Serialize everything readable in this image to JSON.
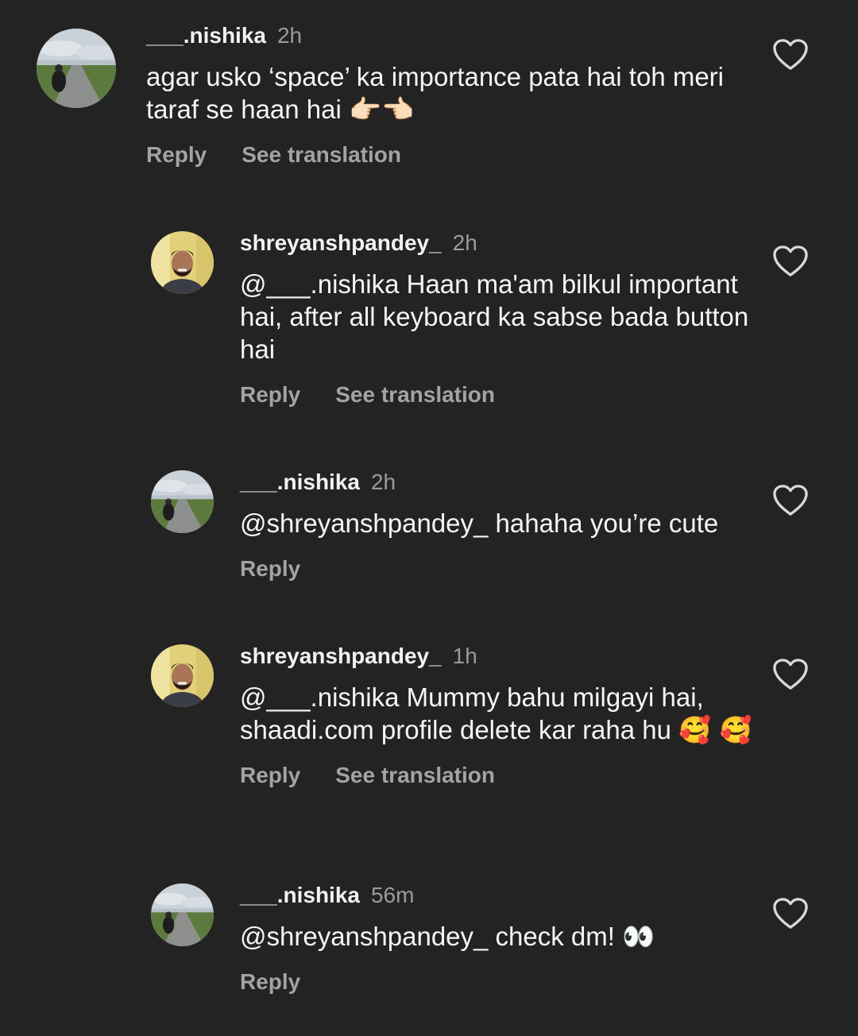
{
  "comments": [
    {
      "username": "___.nishika",
      "time": "2h",
      "text": "agar usko ‘space’ ka importance pata hai toh meri taraf se haan hai",
      "emoji": "👉🏻👈🏻",
      "reply_label": "Reply",
      "translate_label": "See translation"
    },
    {
      "username": "shreyanshpandey_",
      "time": "2h",
      "text": "@___.nishika Haan ma'am bilkul important hai, after all keyboard ka sabse bada button hai",
      "emoji": "",
      "reply_label": "Reply",
      "translate_label": "See translation"
    },
    {
      "username": "___.nishika",
      "time": "2h",
      "text": "@shreyanshpandey_ hahaha you’re cute",
      "emoji": "",
      "reply_label": "Reply",
      "translate_label": ""
    },
    {
      "username": "shreyanshpandey_",
      "time": "1h",
      "text": "@___.nishika Mummy bahu milgayi hai, shaadi.com profile delete kar raha hu",
      "emoji": "🥰 🥰",
      "reply_label": "Reply",
      "translate_label": "See translation"
    },
    {
      "username": "___.nishika",
      "time": "56m",
      "text": "@shreyanshpandey_ check dm!",
      "emoji": "👀",
      "reply_label": "Reply",
      "translate_label": ""
    }
  ],
  "icons": {
    "like": "heart-outline-icon",
    "avatar_nishika": "road-landscape-avatar",
    "avatar_shreyansh": "man-portrait-avatar"
  },
  "colors": {
    "background": "#232323",
    "username": "#f2f2f2",
    "meta_gray": "#9b9b9b",
    "action_gray": "#a3a3a3"
  }
}
